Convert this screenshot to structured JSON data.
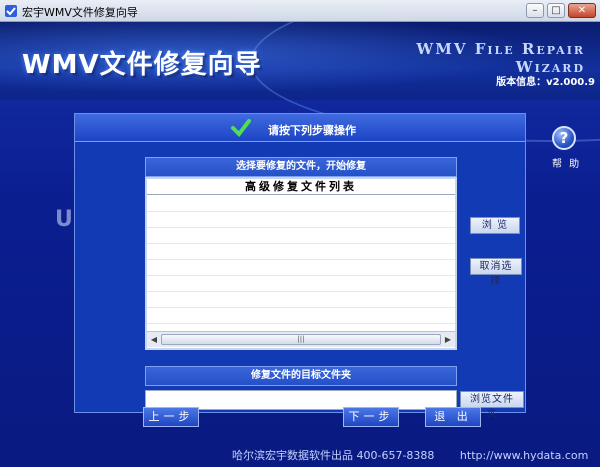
{
  "window": {
    "title": "宏宇WMV文件修复向导",
    "minimize": "–",
    "maximize": "□",
    "close": "✕"
  },
  "header": {
    "title": "WMV文件修复向导",
    "subtitle": "WMV File Repair Wizard",
    "version": "版本信息：v2.000.9"
  },
  "watermark": "UEBUG",
  "panel": {
    "title": "请按下列步骤操作",
    "list_caption": "选择要修复的文件，开始修复",
    "list_header": "高级修复文件列表",
    "browse_label": "浏 览",
    "deselect_label": "取消选择",
    "target_caption": "修复文件的目标文件夹",
    "target_value": "",
    "browse_folder_label": "浏览文件夹"
  },
  "help": {
    "label": "帮 助"
  },
  "nav": {
    "prev_label": "上一步",
    "next_label": "下一步",
    "exit_label": "退 出"
  },
  "footer": {
    "company": "哈尔滨宏宇数据软件出品  400-657-8388",
    "url": "http://www.hydata.com"
  },
  "colors": {
    "background": "#0a1f8c",
    "panel": "#123ab5",
    "button": "#1f45c2"
  }
}
